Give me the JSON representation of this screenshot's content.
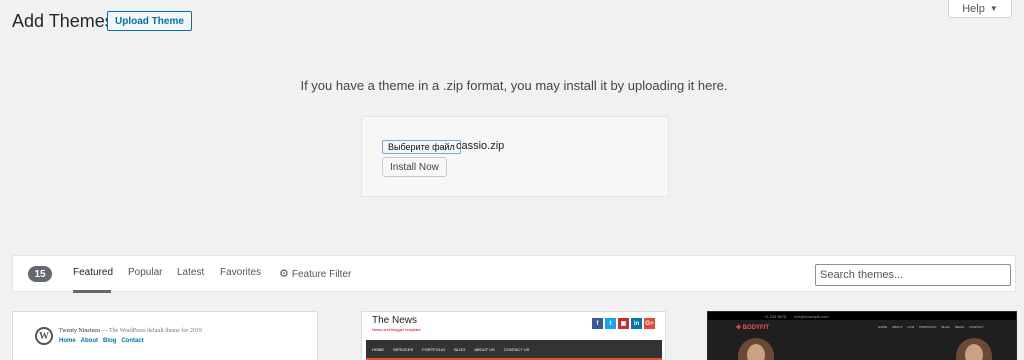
{
  "help_tab": {
    "label": "Help"
  },
  "header": {
    "title": "Add Themes",
    "upload_button": "Upload Theme"
  },
  "upload": {
    "help_text": "If you have a theme in a .zip format, you may install it by uploading it here.",
    "file_button": "Выберите файл",
    "file_name": "cassio.zip",
    "install_button": "Install Now"
  },
  "filter": {
    "count": "15",
    "tabs": [
      {
        "label": "Featured",
        "active": true
      },
      {
        "label": "Popular"
      },
      {
        "label": "Latest"
      },
      {
        "label": "Favorites"
      }
    ],
    "feature_filter": "Feature Filter",
    "search_placeholder": "Search themes..."
  },
  "themes": [
    {
      "name": "Twenty Nineteen",
      "tagline": "— The WordPress default theme for 2019",
      "nav": [
        "Home",
        "About",
        "Blog",
        "Contact"
      ]
    },
    {
      "name": "The News",
      "subtitle": "News and blogger template",
      "social": [
        {
          "glyph": "f",
          "color": "#3b5998"
        },
        {
          "glyph": "t",
          "color": "#1da1f2"
        },
        {
          "glyph": "▣",
          "color": "#c4302b"
        },
        {
          "glyph": "in",
          "color": "#0077b5"
        },
        {
          "glyph": "G+",
          "color": "#dd4b39"
        }
      ],
      "nav": [
        "HOME",
        "SERVICES",
        "PORTFOLIO",
        "BLOG",
        "ABOUT US",
        "CONTACT US"
      ]
    },
    {
      "logo": "✚ BODYFIT",
      "topbar": [
        "+1 234 5678",
        "info@example.com"
      ],
      "nav": [
        "HOME",
        "ABOUT",
        "GYM",
        "PORTFOLIO",
        "BLOG",
        "MEDIA",
        "CONTACT"
      ]
    }
  ]
}
